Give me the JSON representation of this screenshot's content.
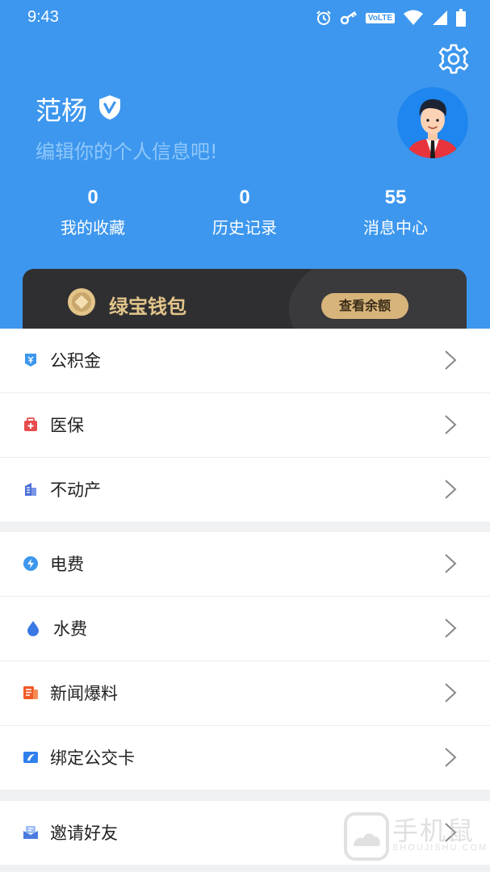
{
  "status_bar": {
    "time": "9:43",
    "volte": "VoLTE",
    "icons": [
      "alarm-icon",
      "key-icon",
      "volte-icon",
      "wifi-icon",
      "signal-icon",
      "battery-icon"
    ]
  },
  "profile": {
    "name": "范杨",
    "subtitle": "编辑你的个人信息吧!",
    "stats": [
      {
        "value": "0",
        "label": "我的收藏"
      },
      {
        "value": "0",
        "label": "历史记录"
      },
      {
        "value": "55",
        "label": "消息中心"
      }
    ]
  },
  "wallet": {
    "title": "绿宝钱包",
    "button": "查看余额"
  },
  "groups": [
    {
      "items": [
        {
          "label": "公积金",
          "icon": "housing-fund-icon"
        },
        {
          "label": "医保",
          "icon": "medical-insurance-icon"
        },
        {
          "label": "不动产",
          "icon": "real-estate-icon"
        }
      ]
    },
    {
      "items": [
        {
          "label": "电费",
          "icon": "electricity-icon"
        },
        {
          "label": "水费",
          "icon": "water-drop-icon"
        },
        {
          "label": "新闻爆料",
          "icon": "news-icon"
        },
        {
          "label": "绑定公交卡",
          "icon": "bus-card-icon"
        }
      ]
    },
    {
      "items": [
        {
          "label": "邀请好友",
          "icon": "invite-mail-icon"
        }
      ]
    }
  ],
  "watermark": {
    "text": "手机鼠",
    "sub": "SHOUJISHU.COM"
  },
  "colors": {
    "header": "#3d97ee",
    "wallet_bg": "#2f2f31",
    "wallet_gold": "#e3c58a",
    "wallet_button": "#d7b47a"
  }
}
